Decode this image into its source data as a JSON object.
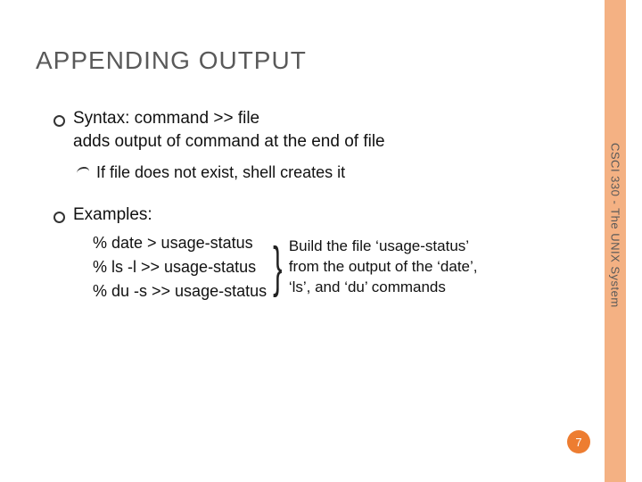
{
  "title": "APPENDING OUTPUT",
  "syntax_line1": "Syntax: command >> file",
  "syntax_line2": "adds output of command at the end of file",
  "sub_note": "If file does not exist, shell creates it",
  "examples_label": "Examples:",
  "cmds": {
    "c1": "% date > usage-status",
    "c2": "% ls -l >> usage-status",
    "c3": "% du -s >> usage-status"
  },
  "explain": "Build the file ‘usage-status’ from the output of the ‘date’, ‘ls’, and ‘du’ commands",
  "sidebar_label": "CSCI 330 - The UNIX System",
  "page_number": "7",
  "colors": {
    "accent": "#f4b183",
    "badge": "#ed7d31"
  }
}
